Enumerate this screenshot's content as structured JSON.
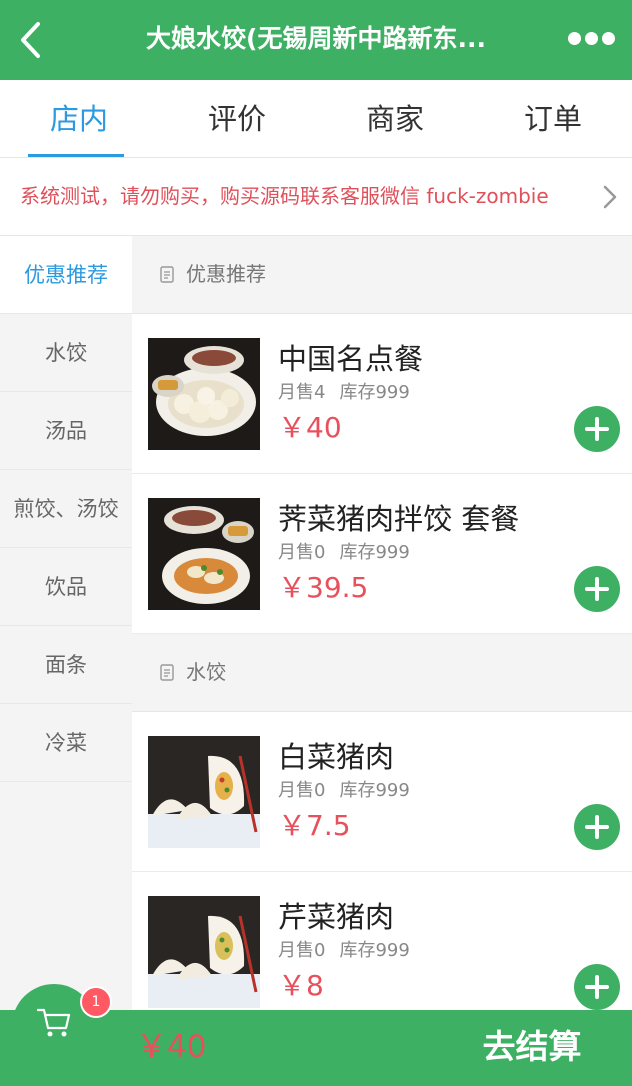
{
  "header": {
    "title": "大娘水饺(无锡周新中路新东...",
    "back_icon": "back-arrow-icon",
    "more_icon": "more-dots-icon"
  },
  "tabs": [
    {
      "label": "店内",
      "active": true
    },
    {
      "label": "评价",
      "active": false
    },
    {
      "label": "商家",
      "active": false
    },
    {
      "label": "订单",
      "active": false
    }
  ],
  "notice": {
    "text": "系统测试，请勿购买，购买源码联系客服微信 fuck-zombie",
    "arrow_icon": "chevron-right-icon"
  },
  "sidebar": {
    "items": [
      {
        "label": "优惠推荐",
        "active": true
      },
      {
        "label": "水饺",
        "active": false
      },
      {
        "label": "汤品",
        "active": false
      },
      {
        "label": "煎饺、汤饺",
        "active": false
      },
      {
        "label": "饮品",
        "active": false
      },
      {
        "label": "面条",
        "active": false
      },
      {
        "label": "冷菜",
        "active": false
      }
    ]
  },
  "sections": [
    {
      "title": "优惠推荐",
      "products": [
        {
          "name": "中国名点餐",
          "sold": "月售4",
          "stock": "库存999",
          "price": "￥40"
        },
        {
          "name": "荠菜猪肉拌饺 套餐",
          "sold": "月售0",
          "stock": "库存999",
          "price": "￥39.5"
        }
      ]
    },
    {
      "title": "水饺",
      "products": [
        {
          "name": "白菜猪肉",
          "sold": "月售0",
          "stock": "库存999",
          "price": "￥7.5"
        },
        {
          "name": "芹菜猪肉",
          "sold": "月售0",
          "stock": "库存999",
          "price": "￥8"
        }
      ]
    }
  ],
  "cart": {
    "count": "1",
    "total": "￥40",
    "checkout_label": "去结算",
    "icon": "shopping-cart-icon"
  },
  "colors": {
    "brand_green": "#3eb064",
    "active_blue": "#2b9ae0",
    "price_red": "#e8505b",
    "badge_red": "#ff5a64"
  }
}
